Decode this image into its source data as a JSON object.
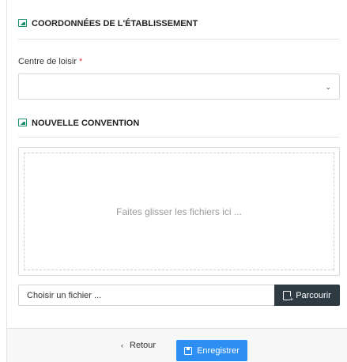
{
  "sections": {
    "establishment": {
      "title": "COORDONNÉES DE L'ÉTABLISSEMENT"
    },
    "convention": {
      "title": "NOUVELLE CONVENTION"
    }
  },
  "form": {
    "leisure_center": {
      "label": "Centre de loisir",
      "required_mark": "*",
      "value": "",
      "chevron": "⌄"
    }
  },
  "upload": {
    "dropzone_hint": "Faites glisser les fichiers ici ...",
    "file_placeholder": "Choisir un fichier ...",
    "browse_label": "Parcourir"
  },
  "footer": {
    "back_label": "Retour",
    "back_chevron": "‹",
    "save_label": "Enregistrer"
  },
  "colors": {
    "accent_green": "#1e8f6e",
    "required_red": "#e13b3b",
    "primary_blue": "#2d8ff2",
    "dark_button": "#2f3b43"
  },
  "icons": {
    "section": "image-icon",
    "browse": "file-plus-icon",
    "save": "floppy-disk-icon",
    "back": "chevron-left-icon",
    "select": "chevron-down-icon"
  }
}
